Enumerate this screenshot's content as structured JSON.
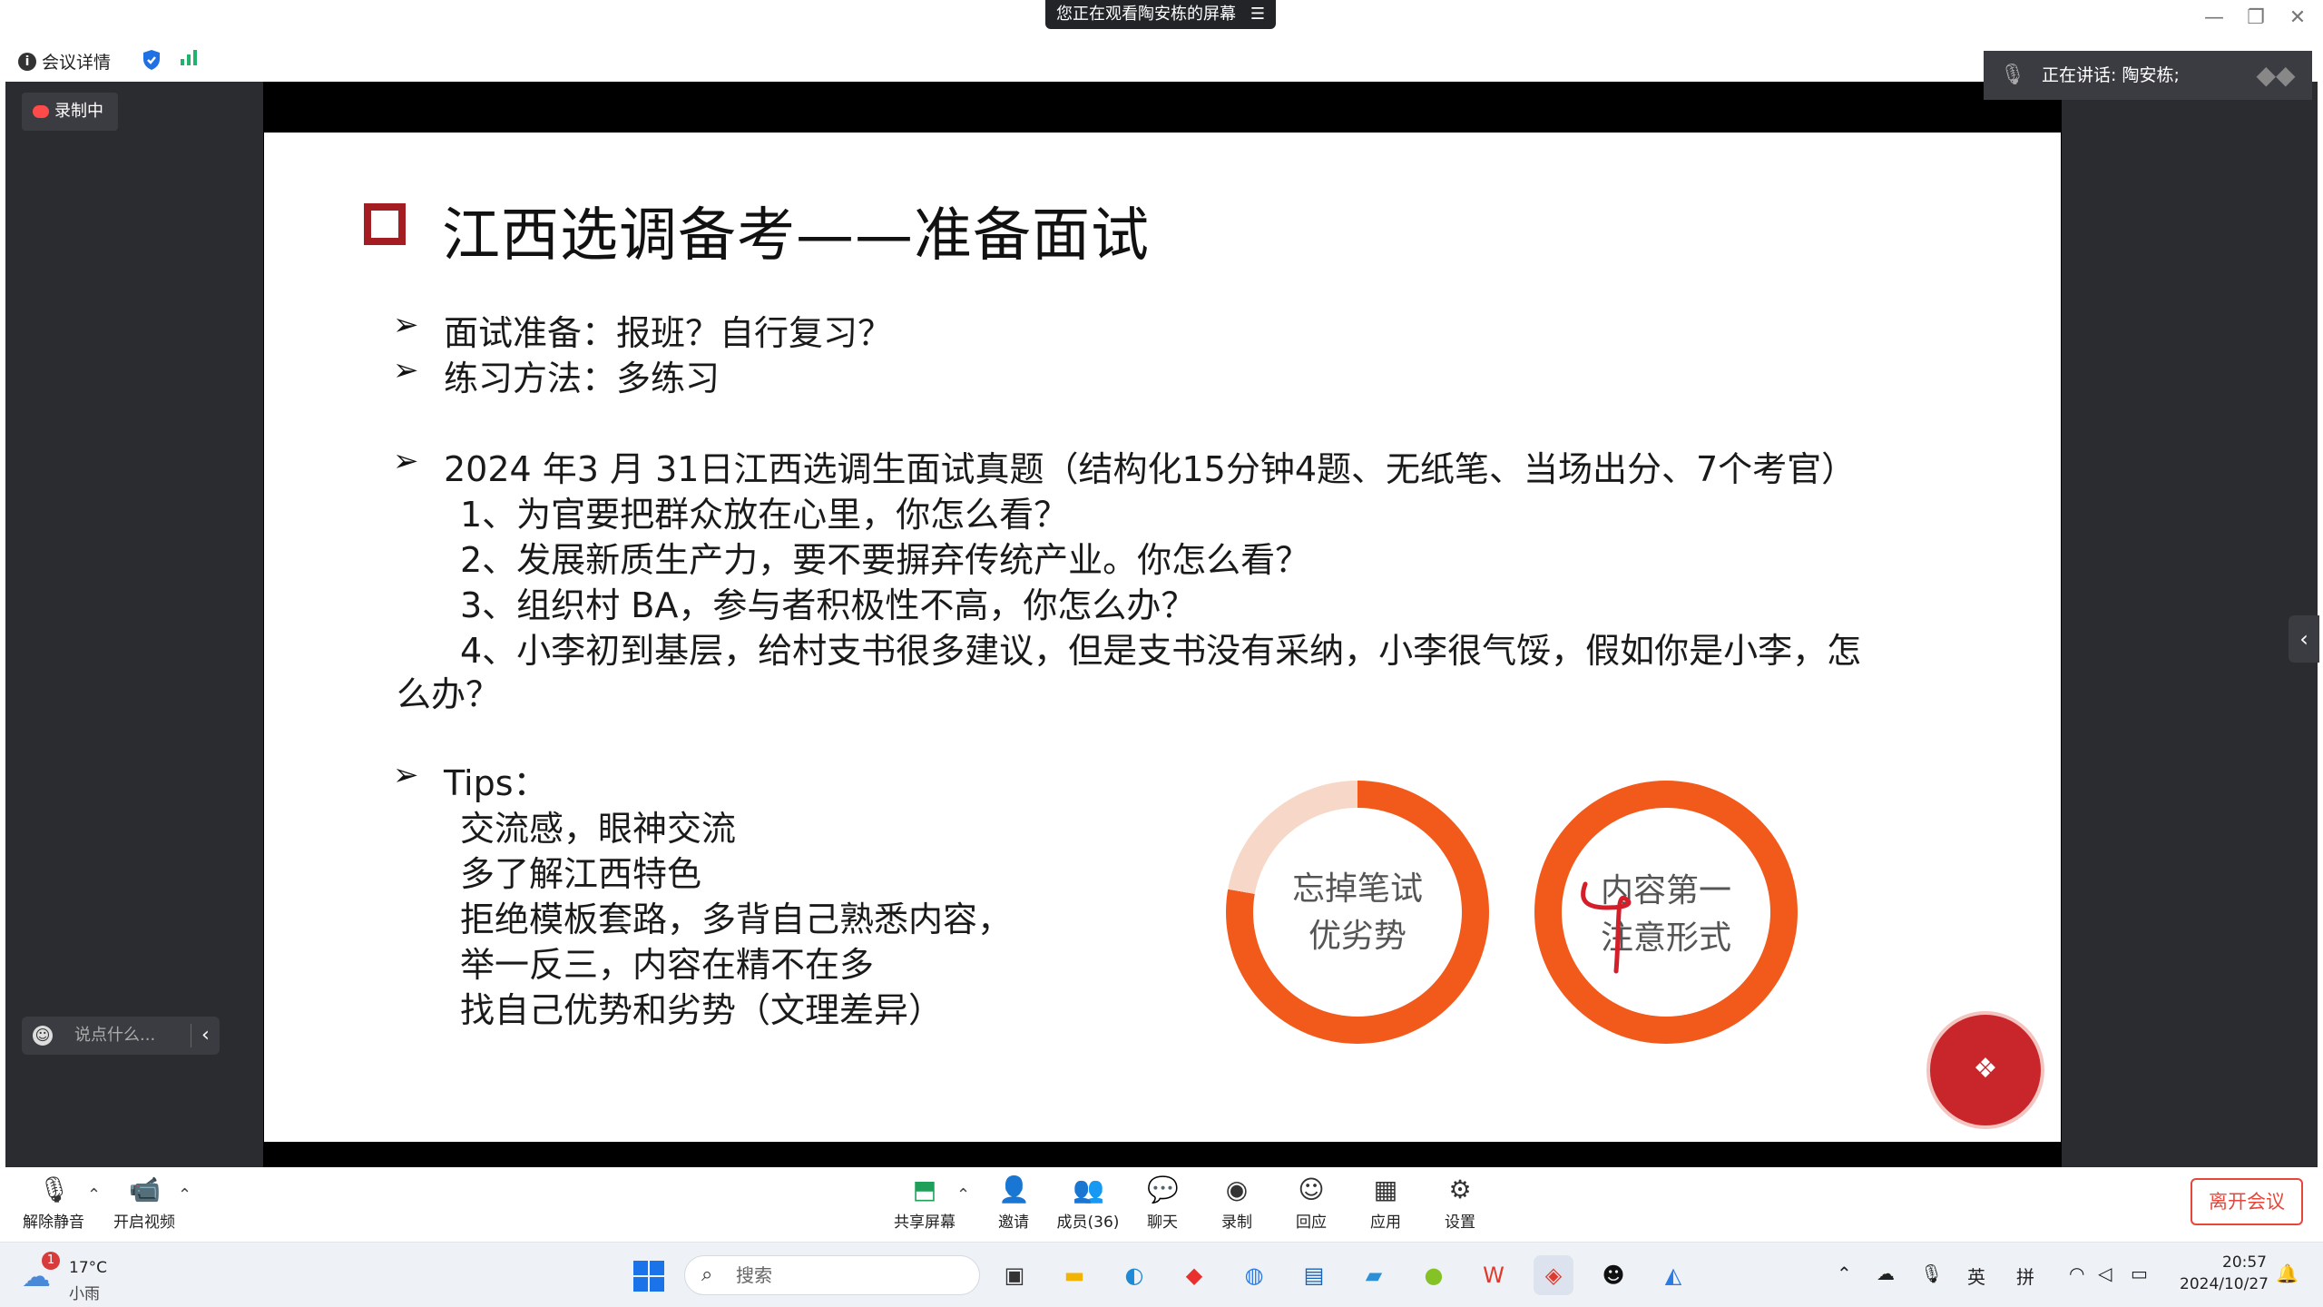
{
  "window": {
    "share_banner": "您正在观看陶安栋的屏幕",
    "menu_glyph": "☰",
    "min_glyph": "—",
    "restore_glyph": "❐",
    "close_glyph": "✕"
  },
  "infobar": {
    "meeting_info": "会议详情"
  },
  "overlay": {
    "recording_label": "录制中",
    "speaking_label": "正在讲话:",
    "speaker_name": "陶安栋;",
    "chat_placeholder": "说点什么...",
    "side_arrow": "‹",
    "chat_arrow": "‹"
  },
  "slide": {
    "title": "江西选调备考——准备面试",
    "bullet_glyph": "➢",
    "lines": {
      "l1": "面试准备：报班？自行复习？",
      "l2": "练习方法：多练习",
      "l3": "2024 年3 月 31日江西选调生面试真题（结构化15分钟4题、无纸笔、当场出分、7个考官）",
      "q1": "1、为官要把群众放在心里，你怎么看？",
      "q2": "2、发展新质生产力，要不要摒弃传统产业。你怎么看？",
      "q3": "3、组织村 BA，参与者积极性不高，你怎么办？",
      "q4a": "4、小李初到基层，给村支书很多建议，但是支书没有采纳，小李很气馁，假如你是小李，怎",
      "q4b": "么办？",
      "tips": "Tips：",
      "t1": "交流感，眼神交流",
      "t2": "多了解江西特色",
      "t3": "拒绝模板套路，多背自己熟悉内容，",
      "t4": "举一反三，内容在精不在多",
      "t5": "找自己优势和劣势（文理差异）"
    },
    "ring1": {
      "line1": "忘掉笔试",
      "line2": "优劣势"
    },
    "ring2": {
      "line1": "内容第一",
      "line2": "注意形式"
    }
  },
  "toolbar": {
    "unmute": "解除静音",
    "video": "开启视频",
    "share": "共享屏幕",
    "invite": "邀请",
    "members": "成员(36)",
    "chat": "聊天",
    "record": "录制",
    "reactions": "回应",
    "apps": "应用",
    "settings": "设置",
    "leave": "离开会议"
  },
  "taskbar": {
    "temp": "17°C",
    "weather": "小雨",
    "weather_badge": "1",
    "search_placeholder": "搜索",
    "ime_lang": "英",
    "ime_mode": "拼",
    "time": "20:57",
    "date": "2024/10/27"
  },
  "colors": {
    "accent_orange": "#f15a1b",
    "title_red": "#a31d22",
    "leave_red": "#e7463b"
  }
}
